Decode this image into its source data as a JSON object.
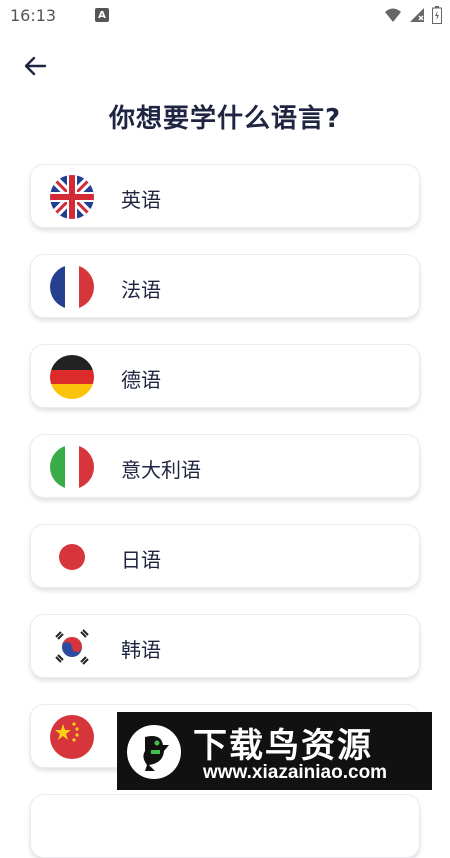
{
  "status_bar": {
    "time": "16:13",
    "notification_letter": "A",
    "icons": [
      "wifi-icon",
      "signal-icon",
      "battery-icon"
    ]
  },
  "header": {
    "back_icon": "arrow-left-icon",
    "title": "你想要学什么语言?"
  },
  "languages": [
    {
      "label": "英语",
      "flag": "uk-flag-icon"
    },
    {
      "label": "法语",
      "flag": "france-flag-icon"
    },
    {
      "label": "德语",
      "flag": "germany-flag-icon"
    },
    {
      "label": "意大利语",
      "flag": "italy-flag-icon"
    },
    {
      "label": "日语",
      "flag": "japan-flag-icon"
    },
    {
      "label": "韩语",
      "flag": "korea-flag-icon"
    },
    {
      "label": "",
      "flag": "china-flag-icon"
    }
  ],
  "watermark": {
    "title": "下载鸟资源",
    "url": "www.xiazainiao.com"
  },
  "colors": {
    "title_text": "#1f2540",
    "card_background": "#ffffff",
    "watermark_background": "#111111"
  }
}
